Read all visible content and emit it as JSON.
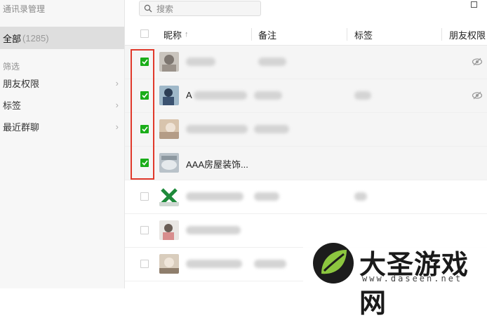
{
  "sidebar": {
    "title": "通讯录管理",
    "all": {
      "label": "全部",
      "count": "(1285)"
    },
    "filter_heading": "筛选",
    "filters": [
      {
        "label": "朋友权限"
      },
      {
        "label": "标签"
      },
      {
        "label": "最近群聊"
      }
    ]
  },
  "search": {
    "placeholder": "搜索"
  },
  "table": {
    "columns": {
      "nickname": "昵称",
      "sort_indicator": "↑",
      "remark": "备注",
      "tag": "标签",
      "permission": "朋友权限"
    },
    "rows": [
      {
        "checked": true,
        "nickname": ""
      },
      {
        "checked": true,
        "nickname": "A"
      },
      {
        "checked": true,
        "nickname": ""
      },
      {
        "checked": true,
        "nickname": "AAA房屋装饰..."
      },
      {
        "checked": false,
        "nickname": ""
      },
      {
        "checked": false,
        "nickname": ""
      },
      {
        "checked": false,
        "nickname": ""
      }
    ]
  },
  "watermark": {
    "brand": "大圣游戏网",
    "url": "www.daseen.net"
  }
}
